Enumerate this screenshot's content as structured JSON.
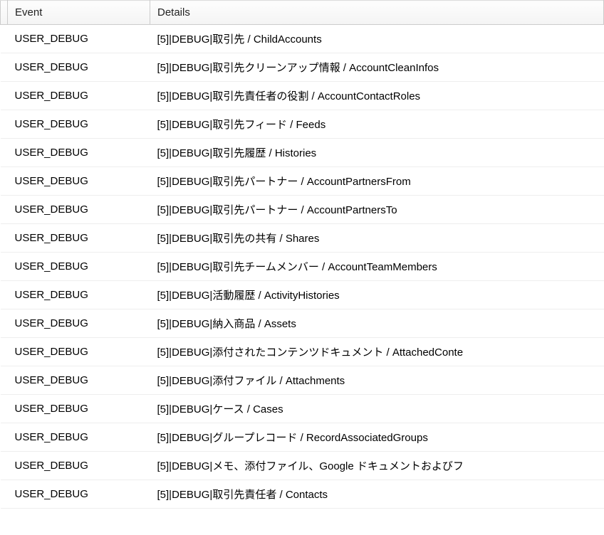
{
  "headers": {
    "checkbox": "",
    "event": "Event",
    "details": "Details"
  },
  "rows": [
    {
      "event": "USER_DEBUG",
      "details": "[5]|DEBUG|取引先 / ChildAccounts"
    },
    {
      "event": "USER_DEBUG",
      "details": "[5]|DEBUG|取引先クリーンアップ情報 / AccountCleanInfos"
    },
    {
      "event": "USER_DEBUG",
      "details": "[5]|DEBUG|取引先責任者の役割 / AccountContactRoles"
    },
    {
      "event": "USER_DEBUG",
      "details": "[5]|DEBUG|取引先フィード / Feeds"
    },
    {
      "event": "USER_DEBUG",
      "details": "[5]|DEBUG|取引先履歴 / Histories"
    },
    {
      "event": "USER_DEBUG",
      "details": "[5]|DEBUG|取引先パートナー / AccountPartnersFrom"
    },
    {
      "event": "USER_DEBUG",
      "details": "[5]|DEBUG|取引先パートナー / AccountPartnersTo"
    },
    {
      "event": "USER_DEBUG",
      "details": "[5]|DEBUG|取引先の共有 / Shares"
    },
    {
      "event": "USER_DEBUG",
      "details": "[5]|DEBUG|取引先チームメンバー / AccountTeamMembers"
    },
    {
      "event": "USER_DEBUG",
      "details": "[5]|DEBUG|活動履歴 / ActivityHistories"
    },
    {
      "event": "USER_DEBUG",
      "details": "[5]|DEBUG|納入商品 / Assets"
    },
    {
      "event": "USER_DEBUG",
      "details": "[5]|DEBUG|添付されたコンテンツドキュメント / AttachedConte"
    },
    {
      "event": "USER_DEBUG",
      "details": "[5]|DEBUG|添付ファイル / Attachments"
    },
    {
      "event": "USER_DEBUG",
      "details": "[5]|DEBUG|ケース / Cases"
    },
    {
      "event": "USER_DEBUG",
      "details": "[5]|DEBUG|グループレコード / RecordAssociatedGroups"
    },
    {
      "event": "USER_DEBUG",
      "details": "[5]|DEBUG|メモ、添付ファイル、Google ドキュメントおよびフ"
    },
    {
      "event": "USER_DEBUG",
      "details": "[5]|DEBUG|取引先責任者 / Contacts"
    }
  ]
}
